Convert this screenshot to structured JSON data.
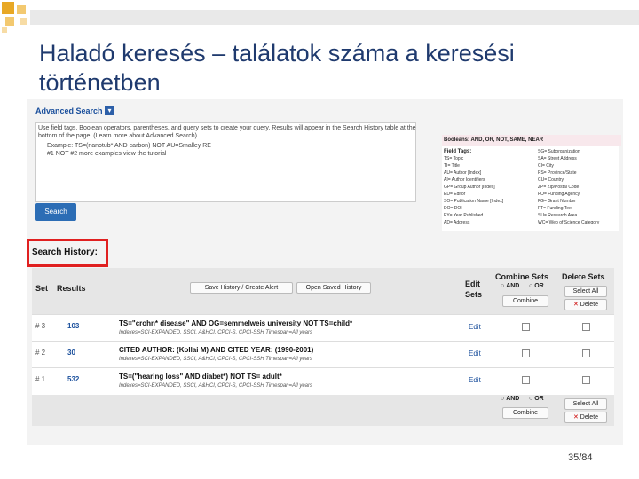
{
  "slide": {
    "title": "Haladó keresés – találatok száma a keresési történetben",
    "page_number": "35/84"
  },
  "search_form": {
    "heading": "Advanced Search",
    "toggle_icon": "chevron-down-icon",
    "help_lines": [
      "Use field tags, Boolean operators, parentheses, and query sets to create your query. Results will appear in the Search History table at the",
      "bottom of the page. (Learn more about Advanced Search)",
      "Example: TS=(nanotub* AND carbon) NOT AU=Smalley RE",
      "#1 NOT #2  more examples  view the tutorial"
    ],
    "search_label": "Search"
  },
  "tags_panel": {
    "booleans": "Booleans: AND, OR, NOT, SAME, NEAR",
    "field_tags_label": "Field Tags:",
    "left_tags": [
      "TS= Topic",
      "TI= Title",
      "AU= Author [Index]",
      "AI= Author Identifiers",
      "GP= Group Author [Index]",
      "ED= Editor",
      "SO= Publication Name [Index]",
      "DO= DOI",
      "PY= Year Published",
      "AD= Address"
    ],
    "right_tags": [
      "SG= Suborganization",
      "SA= Street Address",
      "CI= City",
      "PS= Province/State",
      "CU= Country",
      "ZP= Zip/Postal Code",
      "FO= Funding Agency",
      "FG= Grant Number",
      "FT= Funding Text",
      "SU= Research Area",
      "WC= Web of Science Category"
    ]
  },
  "history": {
    "title": "Search History:",
    "col_set": "Set",
    "col_results": "Results",
    "save_label": "Save History / Create Alert",
    "open_label": "Open Saved History",
    "col_edit": "Edit Sets",
    "col_combine": "Combine Sets",
    "col_delete": "Delete Sets",
    "and_label": "AND",
    "or_label": "OR",
    "combine_label": "Combine",
    "select_all_label": "Select All",
    "delete_label": "Delete",
    "rows": [
      {
        "set": "# 3",
        "results": "103",
        "query": "TS=\"crohn* disease\" AND OG=semmelweis university NOT TS=child*",
        "indexes": "Indexes=SCI-EXPANDED, SSCI, A&HCI, CPCI-S, CPCI-SSH Timespan=All years",
        "edit": "Edit"
      },
      {
        "set": "# 2",
        "results": "30",
        "query": "CITED AUTHOR: (Kollai M) AND CITED YEAR: (1990-2001)",
        "indexes": "Indexes=SCI-EXPANDED, SSCI, A&HCI, CPCI-S, CPCI-SSH Timespan=All years",
        "edit": "Edit"
      },
      {
        "set": "# 1",
        "results": "532",
        "query": "TS=(\"hearing loss\" AND diabet*) NOT TS= adult*",
        "indexes": "Indexes=SCI-EXPANDED, SSCI, A&HCI, CPCI-S, CPCI-SSH Timespan=All years",
        "edit": "Edit"
      }
    ]
  },
  "colors": {
    "title": "#1f3a6e",
    "link": "#1a4f9c",
    "highlight": "#e02020",
    "accent": "#2c6db5"
  }
}
